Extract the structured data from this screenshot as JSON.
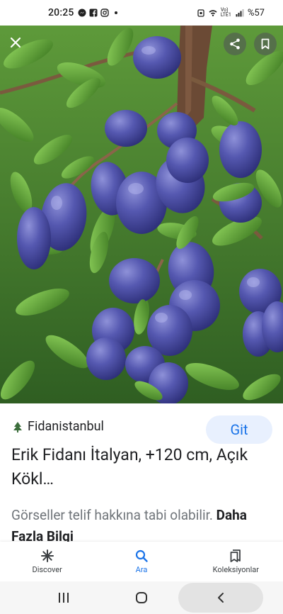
{
  "status_bar": {
    "time": "20:25",
    "battery": "%57",
    "network": "Vo) LTE1"
  },
  "photo": {
    "close_label": "close",
    "share_label": "share",
    "save_label": "save"
  },
  "info": {
    "source": "Fidanistanbul",
    "open_button": "Git",
    "title": "Erik Fidanı İtalyan, +120 cm, Açık Kökl…",
    "copyright": "Görseller telif hakkına tabi olabilir.",
    "more": "Daha Fazla Bilgi"
  },
  "bottom_nav": {
    "items": [
      {
        "label": "Discover",
        "icon": "asterisk-icon"
      },
      {
        "label": "Ara",
        "icon": "search-icon"
      },
      {
        "label": "Koleksiyonlar",
        "icon": "collections-icon"
      }
    ]
  },
  "colors": {
    "accent": "#1a73e8",
    "accent_bg": "#e8f0fe",
    "plum": "#4b4fa3",
    "leaf": "#4e8a2e"
  }
}
